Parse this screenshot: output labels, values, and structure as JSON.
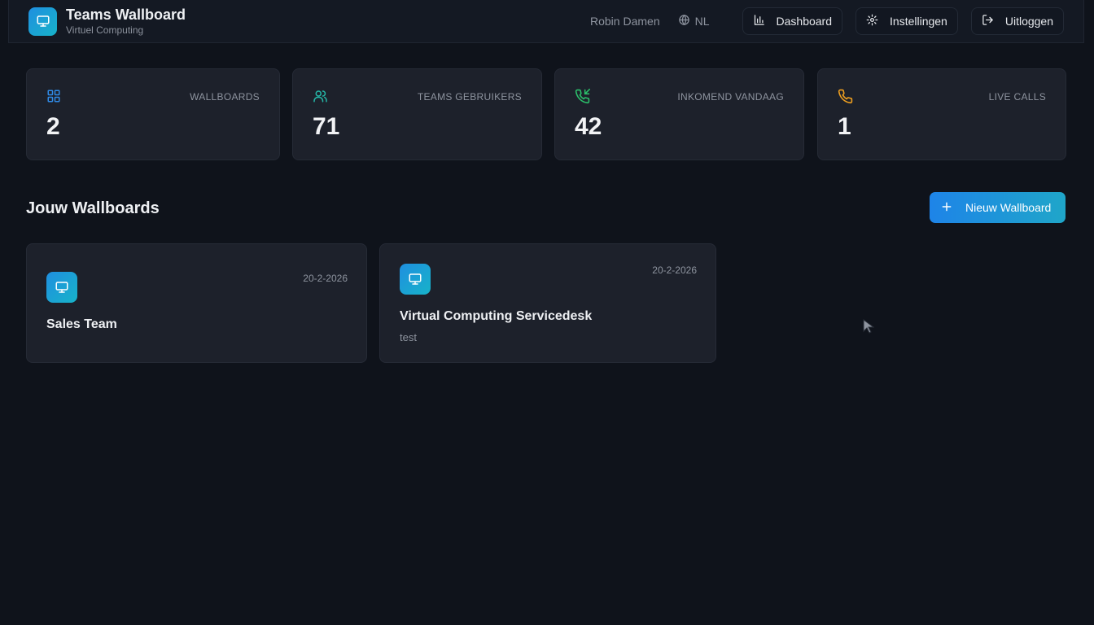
{
  "header": {
    "title": "Teams Wallboard",
    "subtitle": "Virtuel Computing",
    "user": "Robin Damen",
    "language": "NL",
    "nav": {
      "dashboard": "Dashboard",
      "settings": "Instellingen",
      "logout": "Uitloggen"
    }
  },
  "stats": [
    {
      "label": "WALLBOARDS",
      "value": "2",
      "icon": "grid-icon",
      "color": "#2f8ae6"
    },
    {
      "label": "TEAMS GEBRUIKERS",
      "value": "71",
      "icon": "users-icon",
      "color": "#25b8a8"
    },
    {
      "label": "INKOMEND VANDAAG",
      "value": "42",
      "icon": "phone-incoming-icon",
      "color": "#2bbf6a"
    },
    {
      "label": "LIVE CALLS",
      "value": "1",
      "icon": "phone-icon",
      "color": "#f0a020"
    }
  ],
  "wallboards_section": {
    "title": "Jouw Wallboards",
    "new_button": "Nieuw Wallboard"
  },
  "wallboards": [
    {
      "name": "Sales Team",
      "description": "",
      "date": "20-2-2026",
      "icon": "monitor-icon"
    },
    {
      "name": "Virtual Computing Servicedesk",
      "description": "test",
      "date": "20-2-2026",
      "icon": "monitor-icon"
    }
  ],
  "colors": {
    "background": "#0f131b",
    "card": "#1d212b",
    "accent_gradient_start": "#1e84e8",
    "accent_gradient_end": "#1fa6c9"
  }
}
